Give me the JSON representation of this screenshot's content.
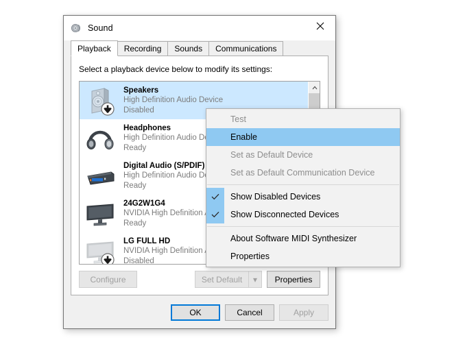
{
  "window": {
    "title": "Sound",
    "icon": "sound-speaker-icon",
    "close_label": "×"
  },
  "tabs": [
    {
      "label": "Playback",
      "active": true
    },
    {
      "label": "Recording",
      "active": false
    },
    {
      "label": "Sounds",
      "active": false
    },
    {
      "label": "Communications",
      "active": false
    }
  ],
  "page": {
    "hint": "Select a playback device below to modify its settings:"
  },
  "devices": [
    {
      "name": "Speakers",
      "description": "High Definition Audio Device",
      "status": "Disabled",
      "icon": "speaker-box-icon",
      "selected": true,
      "disabled_badge": true,
      "dimmed": true
    },
    {
      "name": "Headphones",
      "description": "High Definition Audio Device",
      "status": "Ready",
      "icon": "headphones-icon",
      "selected": false,
      "disabled_badge": false,
      "dimmed": false
    },
    {
      "name": "Digital Audio (S/PDIF)",
      "description": "High Definition Audio Device",
      "status": "Ready",
      "icon": "spdif-box-icon",
      "selected": false,
      "disabled_badge": false,
      "dimmed": false
    },
    {
      "name": "24G2W1G4",
      "description": "NVIDIA High Definition Audio",
      "status": "Ready",
      "icon": "monitor-icon",
      "selected": false,
      "disabled_badge": false,
      "dimmed": false
    },
    {
      "name": "LG FULL HD",
      "description": "NVIDIA High Definition Audio",
      "status": "Disabled",
      "icon": "monitor-icon",
      "selected": false,
      "disabled_badge": true,
      "dimmed": true
    }
  ],
  "scrollbar": {
    "up_arrow": "chevron-up-icon",
    "down_arrow": "chevron-down-icon"
  },
  "page_buttons": {
    "configure": "Configure",
    "set_default": "Set Default",
    "set_default_arrow": "▾",
    "properties": "Properties"
  },
  "dialog_buttons": {
    "ok": "OK",
    "cancel": "Cancel",
    "apply": "Apply"
  },
  "context_menu": [
    {
      "label": "Test",
      "state": "disabled",
      "checked": false,
      "separator_after": false
    },
    {
      "label": "Enable",
      "state": "highlight",
      "checked": false,
      "separator_after": false
    },
    {
      "label": "Set as Default Device",
      "state": "disabled",
      "checked": false,
      "separator_after": false
    },
    {
      "label": "Set as Default Communication Device",
      "state": "disabled",
      "checked": false,
      "separator_after": true
    },
    {
      "label": "Show Disabled Devices",
      "state": "normal",
      "checked": true,
      "separator_after": false
    },
    {
      "label": "Show Disconnected Devices",
      "state": "normal",
      "checked": true,
      "separator_after": true
    },
    {
      "label": "About Software MIDI Synthesizer",
      "state": "normal",
      "checked": false,
      "separator_after": false
    },
    {
      "label": "Properties",
      "state": "normal",
      "checked": false,
      "separator_after": false
    }
  ],
  "colors": {
    "selection_blue": "#cce8ff",
    "menu_highlight": "#8fc9f2",
    "focus_border": "#0078d7",
    "dialog_face": "#f0f0f0",
    "muted_text": "#7c7c7c"
  }
}
